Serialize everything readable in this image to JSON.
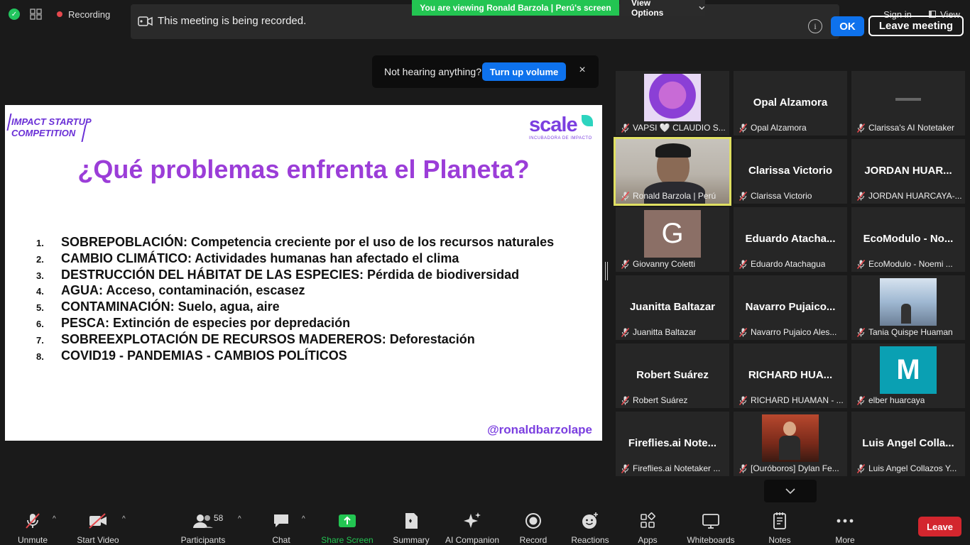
{
  "topbar": {
    "recording_label": "Recording",
    "viewing_banner": "You are viewing Ronald Barzola | Perú's screen",
    "view_options_label": "View Options",
    "sign_in_label": "Sign in",
    "view_label": "View"
  },
  "recording_notice": {
    "message": "This meeting is being recorded.",
    "info_glyph": "i",
    "ok_label": "OK",
    "leave_meeting_label": "Leave meeting"
  },
  "audio_toast": {
    "message": "Not hearing anything?",
    "button_label": "Turn up volume",
    "close_glyph": "×"
  },
  "slide": {
    "brand_left_line1": "IMPACT STARTUP",
    "brand_left_line2": "COMPETITION",
    "brand_right_name": "scale",
    "brand_right_sub": "INCUBADORA DE IMPACTO",
    "title": "¿Qué problemas enfrenta el Planeta?",
    "items": [
      {
        "num": "1.",
        "text": "SOBREPOBLACIÓN: Competencia creciente por el uso de los recursos naturales"
      },
      {
        "num": "2.",
        "text": "CAMBIO CLIMÁTICO: Actividades humanas han afectado el clima"
      },
      {
        "num": "3.",
        "text": "DESTRUCCIÓN DEL HÁBITAT DE LAS ESPECIES: Pérdida de biodiversidad"
      },
      {
        "num": "4.",
        "text": "AGUA: Acceso, contaminación, escasez"
      },
      {
        "num": "5.",
        "text": "CONTAMINACIÓN: Suelo, agua, aire"
      },
      {
        "num": "6.",
        "text": "PESCA: Extinción de especies por depredación"
      },
      {
        "num": "7.",
        "text": "SOBREEXPLOTACIÓN DE RECURSOS MADEREROS: Deforestación"
      },
      {
        "num": "8.",
        "text": "COVID19 - PANDEMIAS - CAMBIOS POLÍTICOS"
      }
    ],
    "handle": "@ronaldbarzolape"
  },
  "gallery": {
    "tiles": [
      {
        "display": "",
        "label": "VAPSI 🤍 CLAUDIO S...",
        "kind": "logo"
      },
      {
        "display": "Opal Alzamora",
        "label": "Opal Alzamora",
        "kind": "name"
      },
      {
        "display": "",
        "label": "Clarissa's AI Notetaker",
        "kind": "dark"
      },
      {
        "display": "",
        "label": "Ronald Barzola | Perú",
        "kind": "video"
      },
      {
        "display": "Clarissa Victorio",
        "label": "Clarissa Victorio",
        "kind": "name"
      },
      {
        "display": "JORDAN HUAR...",
        "label": "JORDAN HUARCAYA-...",
        "kind": "name"
      },
      {
        "display": "G",
        "label": "Giovanny Coletti",
        "kind": "avatar-g"
      },
      {
        "display": "Eduardo Atacha...",
        "label": "Eduardo Atachagua",
        "kind": "name"
      },
      {
        "display": "EcoModulo - No...",
        "label": "EcoModulo - Noemi ...",
        "kind": "name"
      },
      {
        "display": "Juanitta Baltazar",
        "label": "Juanitta Baltazar",
        "kind": "name"
      },
      {
        "display": "Navarro Pujaico...",
        "label": "Navarro Pujaico Ales...",
        "kind": "name"
      },
      {
        "display": "",
        "label": "Tania Quispe Huaman",
        "kind": "photo-blue"
      },
      {
        "display": "Robert Suárez",
        "label": "Robert Suárez",
        "kind": "name"
      },
      {
        "display": "RICHARD HUA...",
        "label": "RICHARD HUAMAN - ...",
        "kind": "name"
      },
      {
        "display": "M",
        "label": "elber huarcaya",
        "kind": "avatar-m"
      },
      {
        "display": "Fireflies.ai Note...",
        "label": "Fireflies.ai Notetaker ...",
        "kind": "name"
      },
      {
        "display": "",
        "label": "[Ouróboros] Dylan Fe...",
        "kind": "photo-red"
      },
      {
        "display": "Luis Angel Colla...",
        "label": "Luis Angel Collazos Y...",
        "kind": "name"
      }
    ]
  },
  "toolbar": {
    "unmute": "Unmute",
    "start_video": "Start Video",
    "participants": "Participants",
    "participant_count": "58",
    "chat": "Chat",
    "share_screen": "Share Screen",
    "summary": "Summary",
    "ai_companion": "AI Companion",
    "record": "Record",
    "reactions": "Reactions",
    "apps": "Apps",
    "whiteboards": "Whiteboards",
    "notes": "Notes",
    "more": "More",
    "leave": "Leave"
  },
  "colors": {
    "banner_green": "#23c552",
    "zoom_blue": "#0e72ed",
    "leave_red": "#d3262e",
    "title_purple": "#9b3dd8",
    "active_speaker_border": "#e0e062"
  }
}
